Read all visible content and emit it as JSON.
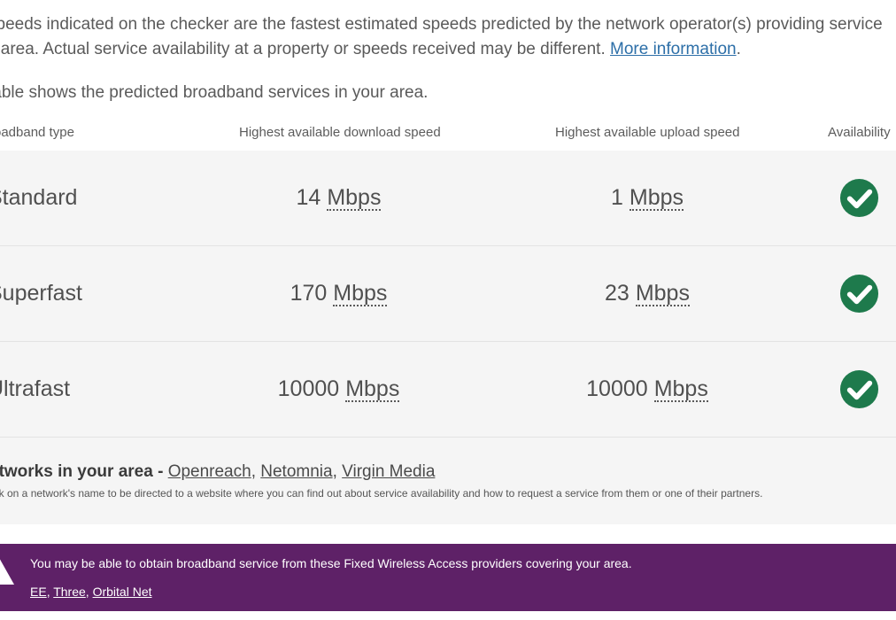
{
  "intro": {
    "line1": "speeds indicated on the checker are the fastest estimated speeds predicted by the network operator(s) providing service",
    "line2": "s area. Actual service availability at a property or speeds received may be different.",
    "more_info_link": "More information",
    "line2_end": "."
  },
  "table_intro": "table shows the predicted broadband services in your area.",
  "table": {
    "headers": {
      "type": "roadband type",
      "download": "Highest available download speed",
      "upload": "Highest available upload speed",
      "availability": "Availability"
    },
    "rows": [
      {
        "type": "Standard",
        "download": "14",
        "download_unit": "Mbps",
        "upload": "1",
        "upload_unit": "Mbps",
        "available": true
      },
      {
        "type": "Superfast",
        "download": "170",
        "download_unit": "Mbps",
        "upload": "23",
        "upload_unit": "Mbps",
        "available": true
      },
      {
        "type": "Ultrafast",
        "download": "10000",
        "download_unit": "Mbps",
        "upload": "10000",
        "upload_unit": "Mbps",
        "available": true
      }
    ]
  },
  "networks": {
    "heading": "etworks in your area",
    "separator": " - ",
    "links": [
      "Openreach",
      "Netomnia",
      "Virgin Media"
    ],
    "link_separator": ", ",
    "note": "ick on a network's name to be directed to a website where you can find out about service availability and how to request a service from them or one of their partners."
  },
  "banner": {
    "text": "You may be able to obtain broadband service from these Fixed Wireless Access providers covering your area.",
    "providers": [
      "EE",
      "Three",
      "Orbital Net"
    ],
    "provider_separator": ", ",
    "background": "#5e2167"
  },
  "colors": {
    "check_green": "#1e7a4c",
    "link_blue": "#2d6fa8",
    "row_background": "#f5f5f5"
  },
  "icons": {
    "availability": "check-circle-icon",
    "banner": "warning-icon"
  }
}
